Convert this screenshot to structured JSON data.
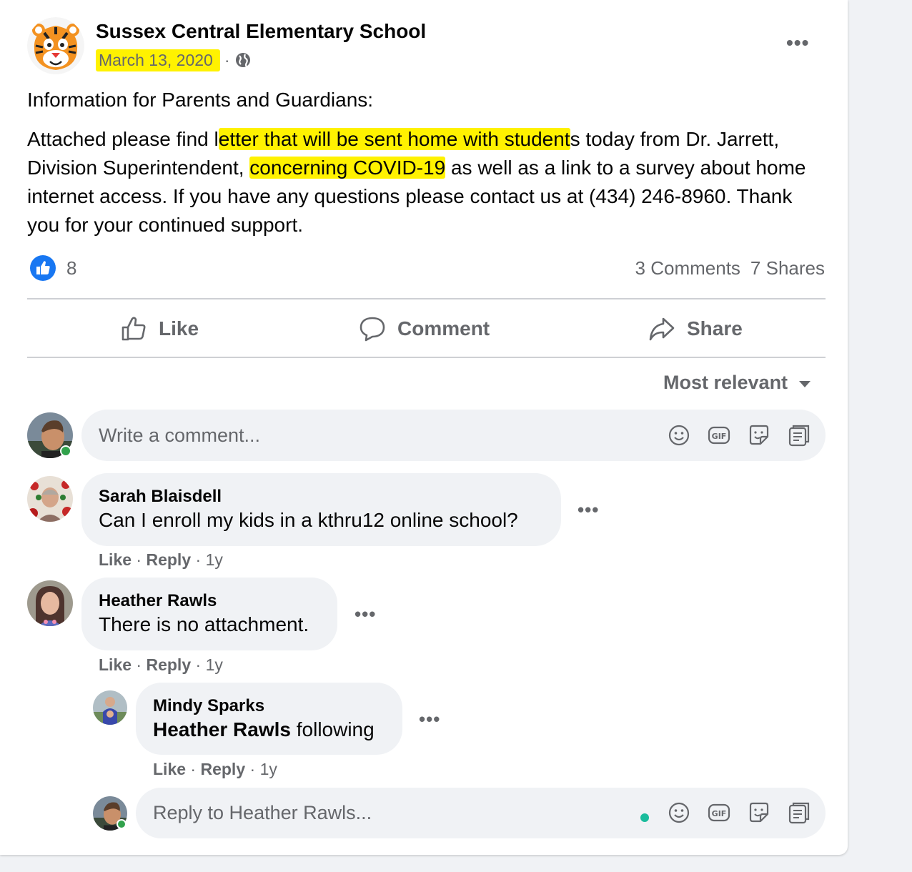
{
  "post": {
    "page_name": "Sussex Central Elementary School",
    "date": "March 13, 2020",
    "separator": "·",
    "audience_icon": "globe-icon",
    "more_icon": "more-horizontal-icon",
    "intro": "Information for Parents and Guardians:",
    "body_pre": "Attached please find l",
    "body_hl1": "etter that will be sent home with student",
    "body_mid": "s today from Dr. Jarrett, Division Superintendent, ",
    "body_hl2": "concerning COVID-19",
    "body_post": " as well as a link to a survey about home internet access. If you have any questions please contact us at (434) 246-8960. Thank you for your continued support.",
    "highlight_color": "#fff200"
  },
  "reactions": {
    "like_count": "8",
    "comments": "3 Comments",
    "shares": "7 Shares"
  },
  "actions": {
    "like": "Like",
    "comment": "Comment",
    "share": "Share"
  },
  "sort": {
    "label": "Most relevant"
  },
  "composer": {
    "placeholder": "Write a comment..."
  },
  "comments": [
    {
      "name": "Sarah Blaisdell",
      "text": "Can I enroll my kids in a kthru12 online school?",
      "like": "Like",
      "reply": "Reply",
      "age": "1y"
    },
    {
      "name": "Heather Rawls",
      "text": "There is no attachment.",
      "like": "Like",
      "reply": "Reply",
      "age": "1y"
    }
  ],
  "reply": {
    "name": "Mindy Sparks",
    "mention": "Heather Rawls",
    "text": "following",
    "like": "Like",
    "reply": "Reply",
    "age": "1y"
  },
  "reply_composer": {
    "placeholder": "Reply to Heather Rawls..."
  },
  "colors": {
    "brand_blue": "#1877f2",
    "secondary_text": "#65676b",
    "online_green": "#31a24c"
  }
}
